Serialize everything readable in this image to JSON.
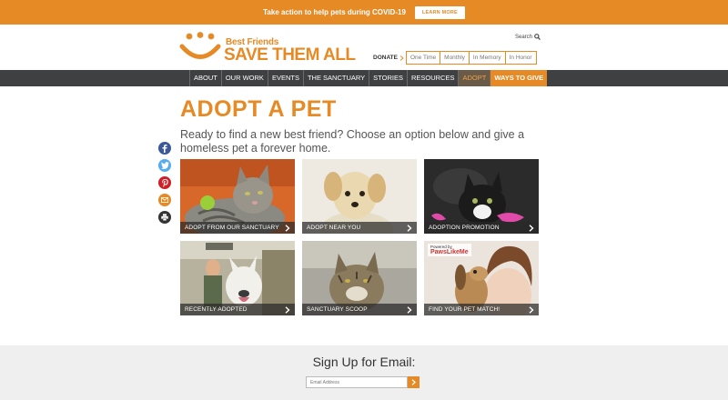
{
  "promo": {
    "text": "Take action to help pets during COVID-19",
    "button": "LEARN MORE"
  },
  "header": {
    "logo_small": "Best Friends",
    "logo_big": "SAVE THEM ALL",
    "search_label": "Search",
    "donate_label": "DONATE",
    "donate_options": [
      "One Time",
      "Monthly",
      "In Memory",
      "In Honor"
    ]
  },
  "nav": {
    "items": [
      "ABOUT",
      "OUR WORK",
      "EVENTS",
      "THE SANCTUARY",
      "STORIES",
      "RESOURCES",
      "ADOPT"
    ],
    "give": "WAYS TO GIVE"
  },
  "main": {
    "title": "ADOPT A PET",
    "intro": "Ready to find a new best friend? Choose an option below and give a homeless pet a forever home.",
    "tiles": [
      "ADOPT FROM OUR SANCTUARY",
      "ADOPT NEAR YOU",
      "ADOPTION PROMOTION",
      "RECENTLY ADOPTED",
      "SANCTUARY SCOOP",
      "FIND YOUR PET MATCH!"
    ],
    "paws_small": "Powered by",
    "paws_big": "PawsLikeMe"
  },
  "footer": {
    "title": "Sign Up for Email:",
    "placeholder": "Email Address"
  },
  "colors": {
    "accent": "#e68a26",
    "nav": "#3f4042"
  }
}
